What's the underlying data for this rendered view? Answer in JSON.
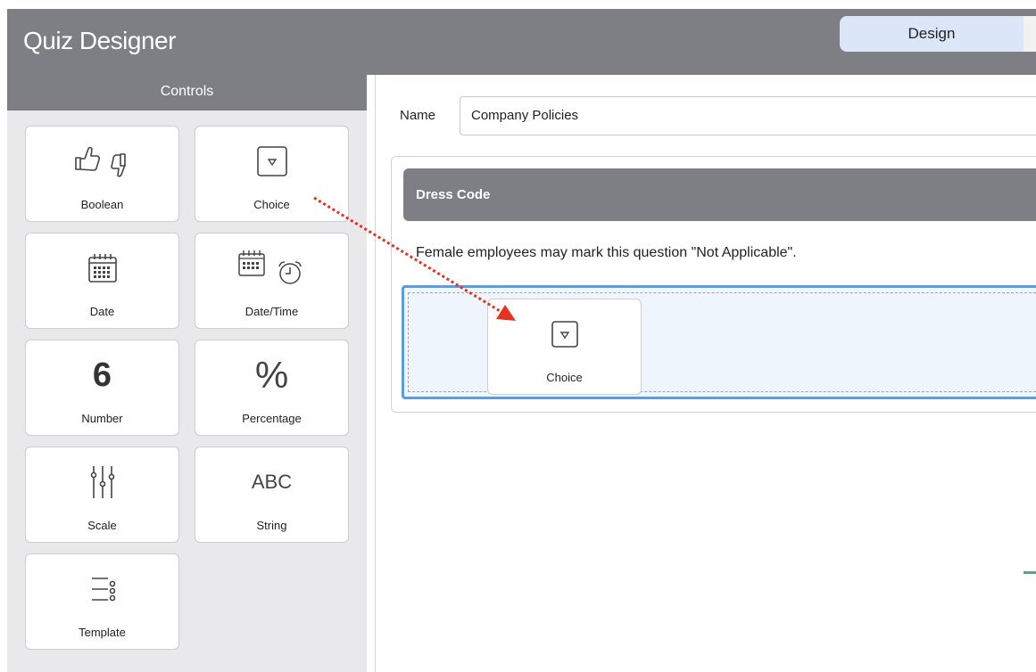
{
  "header": {
    "title": "Quiz Designer",
    "tabs": [
      {
        "label": "Design",
        "active": true
      }
    ]
  },
  "sidebar": {
    "title": "Controls",
    "controls": [
      {
        "label": "Boolean",
        "icon": "thumbs-up-down-icon"
      },
      {
        "label": "Choice",
        "icon": "dropdown-icon"
      },
      {
        "label": "Date",
        "icon": "calendar-icon"
      },
      {
        "label": "Date/Time",
        "icon": "calendar-clock-icon"
      },
      {
        "label": "Number",
        "icon": "number-icon",
        "glyph": "6"
      },
      {
        "label": "Percentage",
        "icon": "percent-icon",
        "glyph": "%"
      },
      {
        "label": "Scale",
        "icon": "sliders-icon"
      },
      {
        "label": "String",
        "icon": "text-icon",
        "glyph": "ABC"
      },
      {
        "label": "Template",
        "icon": "list-options-icon"
      }
    ]
  },
  "form": {
    "name_label": "Name",
    "name_value": "Company Policies"
  },
  "section": {
    "title": "Dress Code",
    "description": "Female employees may mark this question \"Not Applicable\"."
  },
  "drag": {
    "label": "Choice",
    "icon": "dropdown-icon"
  },
  "colors": {
    "header_bg": "#7e7f84",
    "tab_active_bg": "#dbe7f8",
    "drop_border": "#5b9bdf",
    "drag_arrow": "#e8321f"
  }
}
